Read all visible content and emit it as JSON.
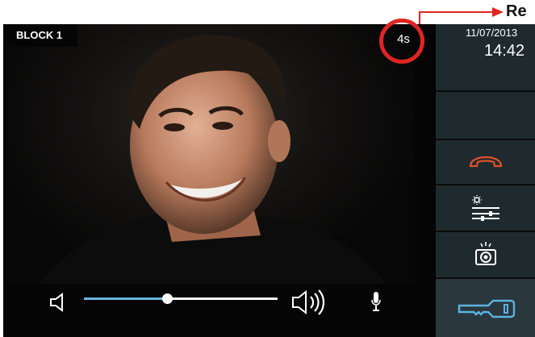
{
  "annotation": {
    "label": "Re",
    "color": "#e02424"
  },
  "screen": {
    "block_label": "BLOCK 1",
    "elapsed_timer": "4s"
  },
  "status": {
    "date": "11/07/2013",
    "time": "14:42"
  },
  "volume": {
    "level": 0.43,
    "track_color": "#ffffff",
    "fill_color": "#6bb6e0"
  },
  "panel": {
    "buttons": [
      {
        "name": "hang-up",
        "icon": "phone-hangup-icon",
        "color": "#e0502a"
      },
      {
        "name": "settings",
        "icon": "sliders-icon"
      },
      {
        "name": "snapshot",
        "icon": "camera-icon"
      },
      {
        "name": "door-unlock",
        "icon": "key-icon",
        "color": "#5ab4e0"
      }
    ]
  }
}
